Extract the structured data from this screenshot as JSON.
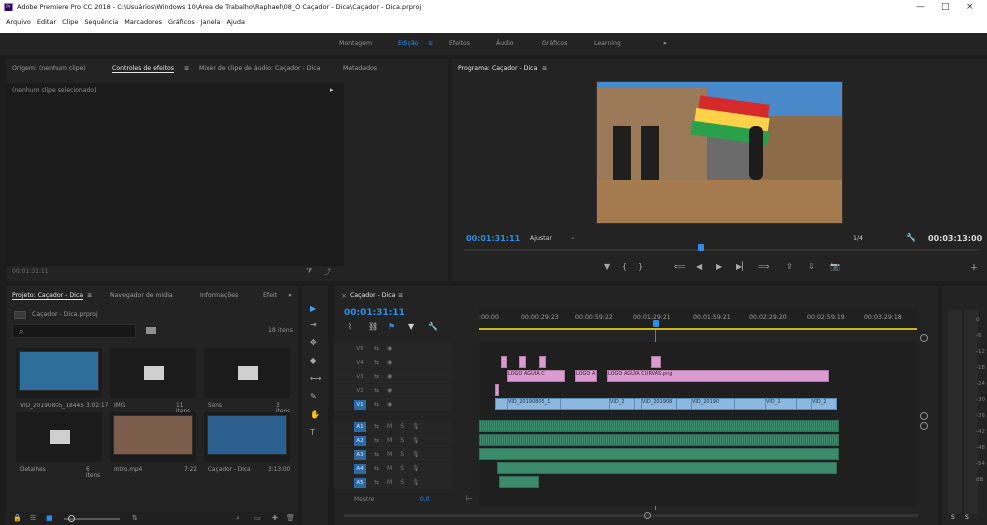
{
  "window": {
    "title": "Adobe Premiere Pro CC 2018 - C:\\Usuários\\Windows 10\\Área de Trabalho\\Raphael\\08_O Caçador - Dica\\Caçador - Dica.prproj",
    "min": "—",
    "max": "□",
    "close": "×"
  },
  "menu": [
    "Arquivo",
    "Editar",
    "Clipe",
    "Sequência",
    "Marcadores",
    "Gráficos",
    "Janela",
    "Ajuda"
  ],
  "workspaces": {
    "items": [
      "Montagem",
      "Edição",
      "Efeitos",
      "Áudio",
      "Gráficos",
      "Learning"
    ],
    "active_index": 1,
    "more": "»",
    "menu_icon": "≡"
  },
  "source_panel": {
    "tabs": [
      "Origem: (nenhum clipe)",
      "Controles de efeitos",
      "Mixer de clipe de áudio: Caçador - Dica",
      "Metadados"
    ],
    "menu_icon": "≡",
    "active_tab": 1,
    "subheader": "(nenhum clipe selecionado)",
    "timecode": "00:01:31:11"
  },
  "program_monitor": {
    "title": "Programa: Caçador - Dica",
    "menu_icon": "≡",
    "timecode": "00:01:31:11",
    "fit_label": "Ajustar",
    "fraction": "1/4",
    "duration": "00:03:13:00"
  },
  "project_panel": {
    "tabs": [
      "Projeto: Caçador - Dica",
      "Navegador de mídia",
      "Informações",
      "Efeit"
    ],
    "menu_icon": "≡",
    "more": "»",
    "project_file": "Caçador - Dica.prproj",
    "item_count": "18 itens",
    "items": [
      {
        "name": "VID_20190805_18445...",
        "meta": "3:02:17",
        "kind": "video",
        "color": "#d9e6ff"
      },
      {
        "name": "IMG",
        "meta": "11 itens",
        "kind": "folder",
        "color": "#bfbfbf"
      },
      {
        "name": "Sons",
        "meta": "3 itens",
        "kind": "folder",
        "color": "#bfbfbf"
      },
      {
        "name": "Detalhes",
        "meta": "6 itens",
        "kind": "folder",
        "color": "#bfbfbf"
      },
      {
        "name": "Intro.mp4",
        "meta": "7:22",
        "kind": "video",
        "color": "#c39a7a"
      },
      {
        "name": "Caçador - Dica",
        "meta": "3:13:00",
        "kind": "sequence",
        "color": "#7fb6ff"
      }
    ]
  },
  "timeline": {
    "sequence_tab": "Caçador - Dica",
    "menu_icon": "≡",
    "close_icon": "×",
    "timecode": "00:01:31:11",
    "ruler_labels": [
      ":00:00",
      "00:00:29:23",
      "00:00:59:22",
      "00:01:29:21",
      "00:01:59:21",
      "00:02:29:20",
      "00:02:59:19",
      "00:03:29:18"
    ],
    "video_tracks": [
      "V5",
      "V4",
      "V3",
      "V2",
      "V1"
    ],
    "audio_tracks": [
      "A1",
      "A2",
      "A3",
      "A4",
      "A5"
    ],
    "master_label": "Mestre",
    "master_value": "0,0",
    "clips": {
      "v3": [
        "LOGO AGUIA C",
        "LOGO A",
        "LOGO AGUIA CURVAS.png"
      ],
      "v1": [
        "VID_20190805_1",
        "VID_2",
        "VID_201908",
        "VID_20190",
        "VID_2",
        "VID_2"
      ]
    }
  },
  "tools": [
    "▶",
    "⇥",
    "✥",
    "◆",
    "⟷",
    "✎",
    "✋",
    "T"
  ],
  "meters": {
    "scale": [
      "0",
      "-6",
      "-12",
      "-18",
      "-24",
      "-30",
      "-36",
      "-42",
      "-48",
      "-54",
      "dB"
    ],
    "solo": [
      "S",
      "S"
    ]
  }
}
